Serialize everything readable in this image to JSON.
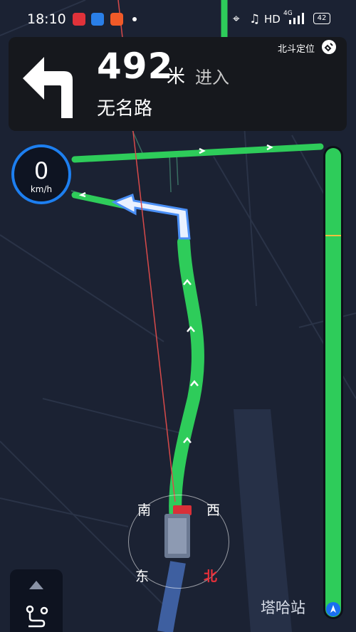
{
  "status_bar": {
    "time": "18:10",
    "hd": "HD",
    "network": "4G",
    "battery": "42"
  },
  "navigation": {
    "distance": "492",
    "unit": "米",
    "action": "进入",
    "road_name": "无名路",
    "positioning": "北斗定位",
    "turn_direction": "left-turn-icon"
  },
  "speedometer": {
    "speed": "0",
    "unit": "km/h"
  },
  "compass": {
    "south": "南",
    "west": "西",
    "east": "东",
    "north": "北"
  },
  "map": {
    "station_label": "塔哈站"
  },
  "route_progress": {
    "remaining_fraction": 1.0
  },
  "colors": {
    "route_green": "#2ecc5a",
    "map_background": "#1b2233",
    "accent_blue": "#1d7ff0",
    "north_red": "#e8303a"
  }
}
